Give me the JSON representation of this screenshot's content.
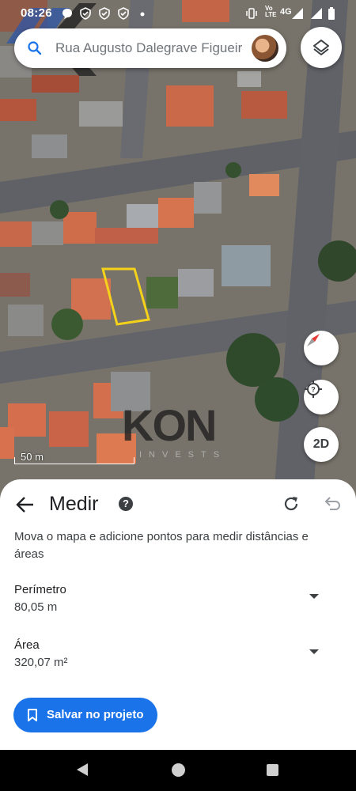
{
  "status_bar": {
    "time": "08:26",
    "network_label": "Vo LTE",
    "signal_label": "4G"
  },
  "search": {
    "query": "Rua Augusto Dalegrave Figueir"
  },
  "map": {
    "scale_label": "50 m",
    "mode_toggle_label": "2D",
    "watermark_word": "KON",
    "watermark_subtitle": "INVESTS",
    "measurement_outline_color": "#f5d21a"
  },
  "sheet": {
    "title": "Medir",
    "help_icon": "?",
    "instructions": "Mova o mapa e adicione pontos para medir distâncias e áreas",
    "perimeter": {
      "label": "Perímetro",
      "value": "80,05 m"
    },
    "area": {
      "label": "Área",
      "value": "320,07 m²"
    },
    "save_button_label": "Salvar no projeto"
  },
  "colors": {
    "accent": "#1a73e8",
    "sheet_background": "#ffffff",
    "roof_tile": "#c9694a"
  }
}
